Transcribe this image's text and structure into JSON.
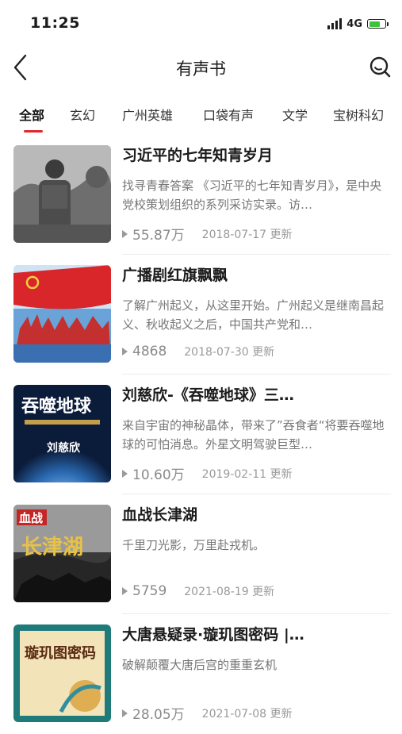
{
  "status_bar": {
    "time": "11:25",
    "network": "4G",
    "battery_level": 0.7,
    "battery_color": "#3ec33b"
  },
  "nav": {
    "title": "有声书",
    "back_icon": "chevron-left-icon",
    "search_icon": "search-icon"
  },
  "tabs": [
    {
      "label": "全部",
      "active": true
    },
    {
      "label": "玄幻",
      "active": false
    },
    {
      "label": "广州英雄",
      "active": false
    },
    {
      "label": "口袋有声",
      "active": false
    },
    {
      "label": "文学",
      "active": false
    },
    {
      "label": "宝树科幻",
      "active": false
    }
  ],
  "accent_color": "#e0282b",
  "items": [
    {
      "title": "习近平的七年知青岁月",
      "desc": "找寻青春答案 《习近平的七年知青岁月》，是中央党校策划组织的系列采访实录。访…",
      "plays": "55.87万",
      "date": "2018-07-17 更新"
    },
    {
      "title": "广播剧红旗飘飘",
      "desc": "了解广州起义，从这里开始。广州起义是继南昌起义、秋收起义之后，中国共产党和…",
      "plays": "4868",
      "date": "2018-07-30 更新"
    },
    {
      "title": "刘慈欣-《吞噬地球》三…",
      "desc": "来自宇宙的神秘晶体，带来了”吞食者“将要吞噬地球的可怕消息。外星文明驾驶巨型…",
      "plays": "10.60万",
      "date": "2019-02-11 更新",
      "cover_text": "吞噬地球",
      "cover_author": "刘慈欣"
    },
    {
      "title": "血战长津湖",
      "desc": "千里刀光影，万里赴戎机。",
      "plays": "5759",
      "date": "2021-08-19 更新",
      "cover_text_1": "血战",
      "cover_text_2": "长津湖"
    },
    {
      "title": "大唐悬疑录·璇玑图密码 |…",
      "desc": "破解颠覆大唐后宫的重重玄机",
      "plays": "28.05万",
      "date": "2021-07-08 更新",
      "cover_text": "璇玑图密码"
    }
  ]
}
